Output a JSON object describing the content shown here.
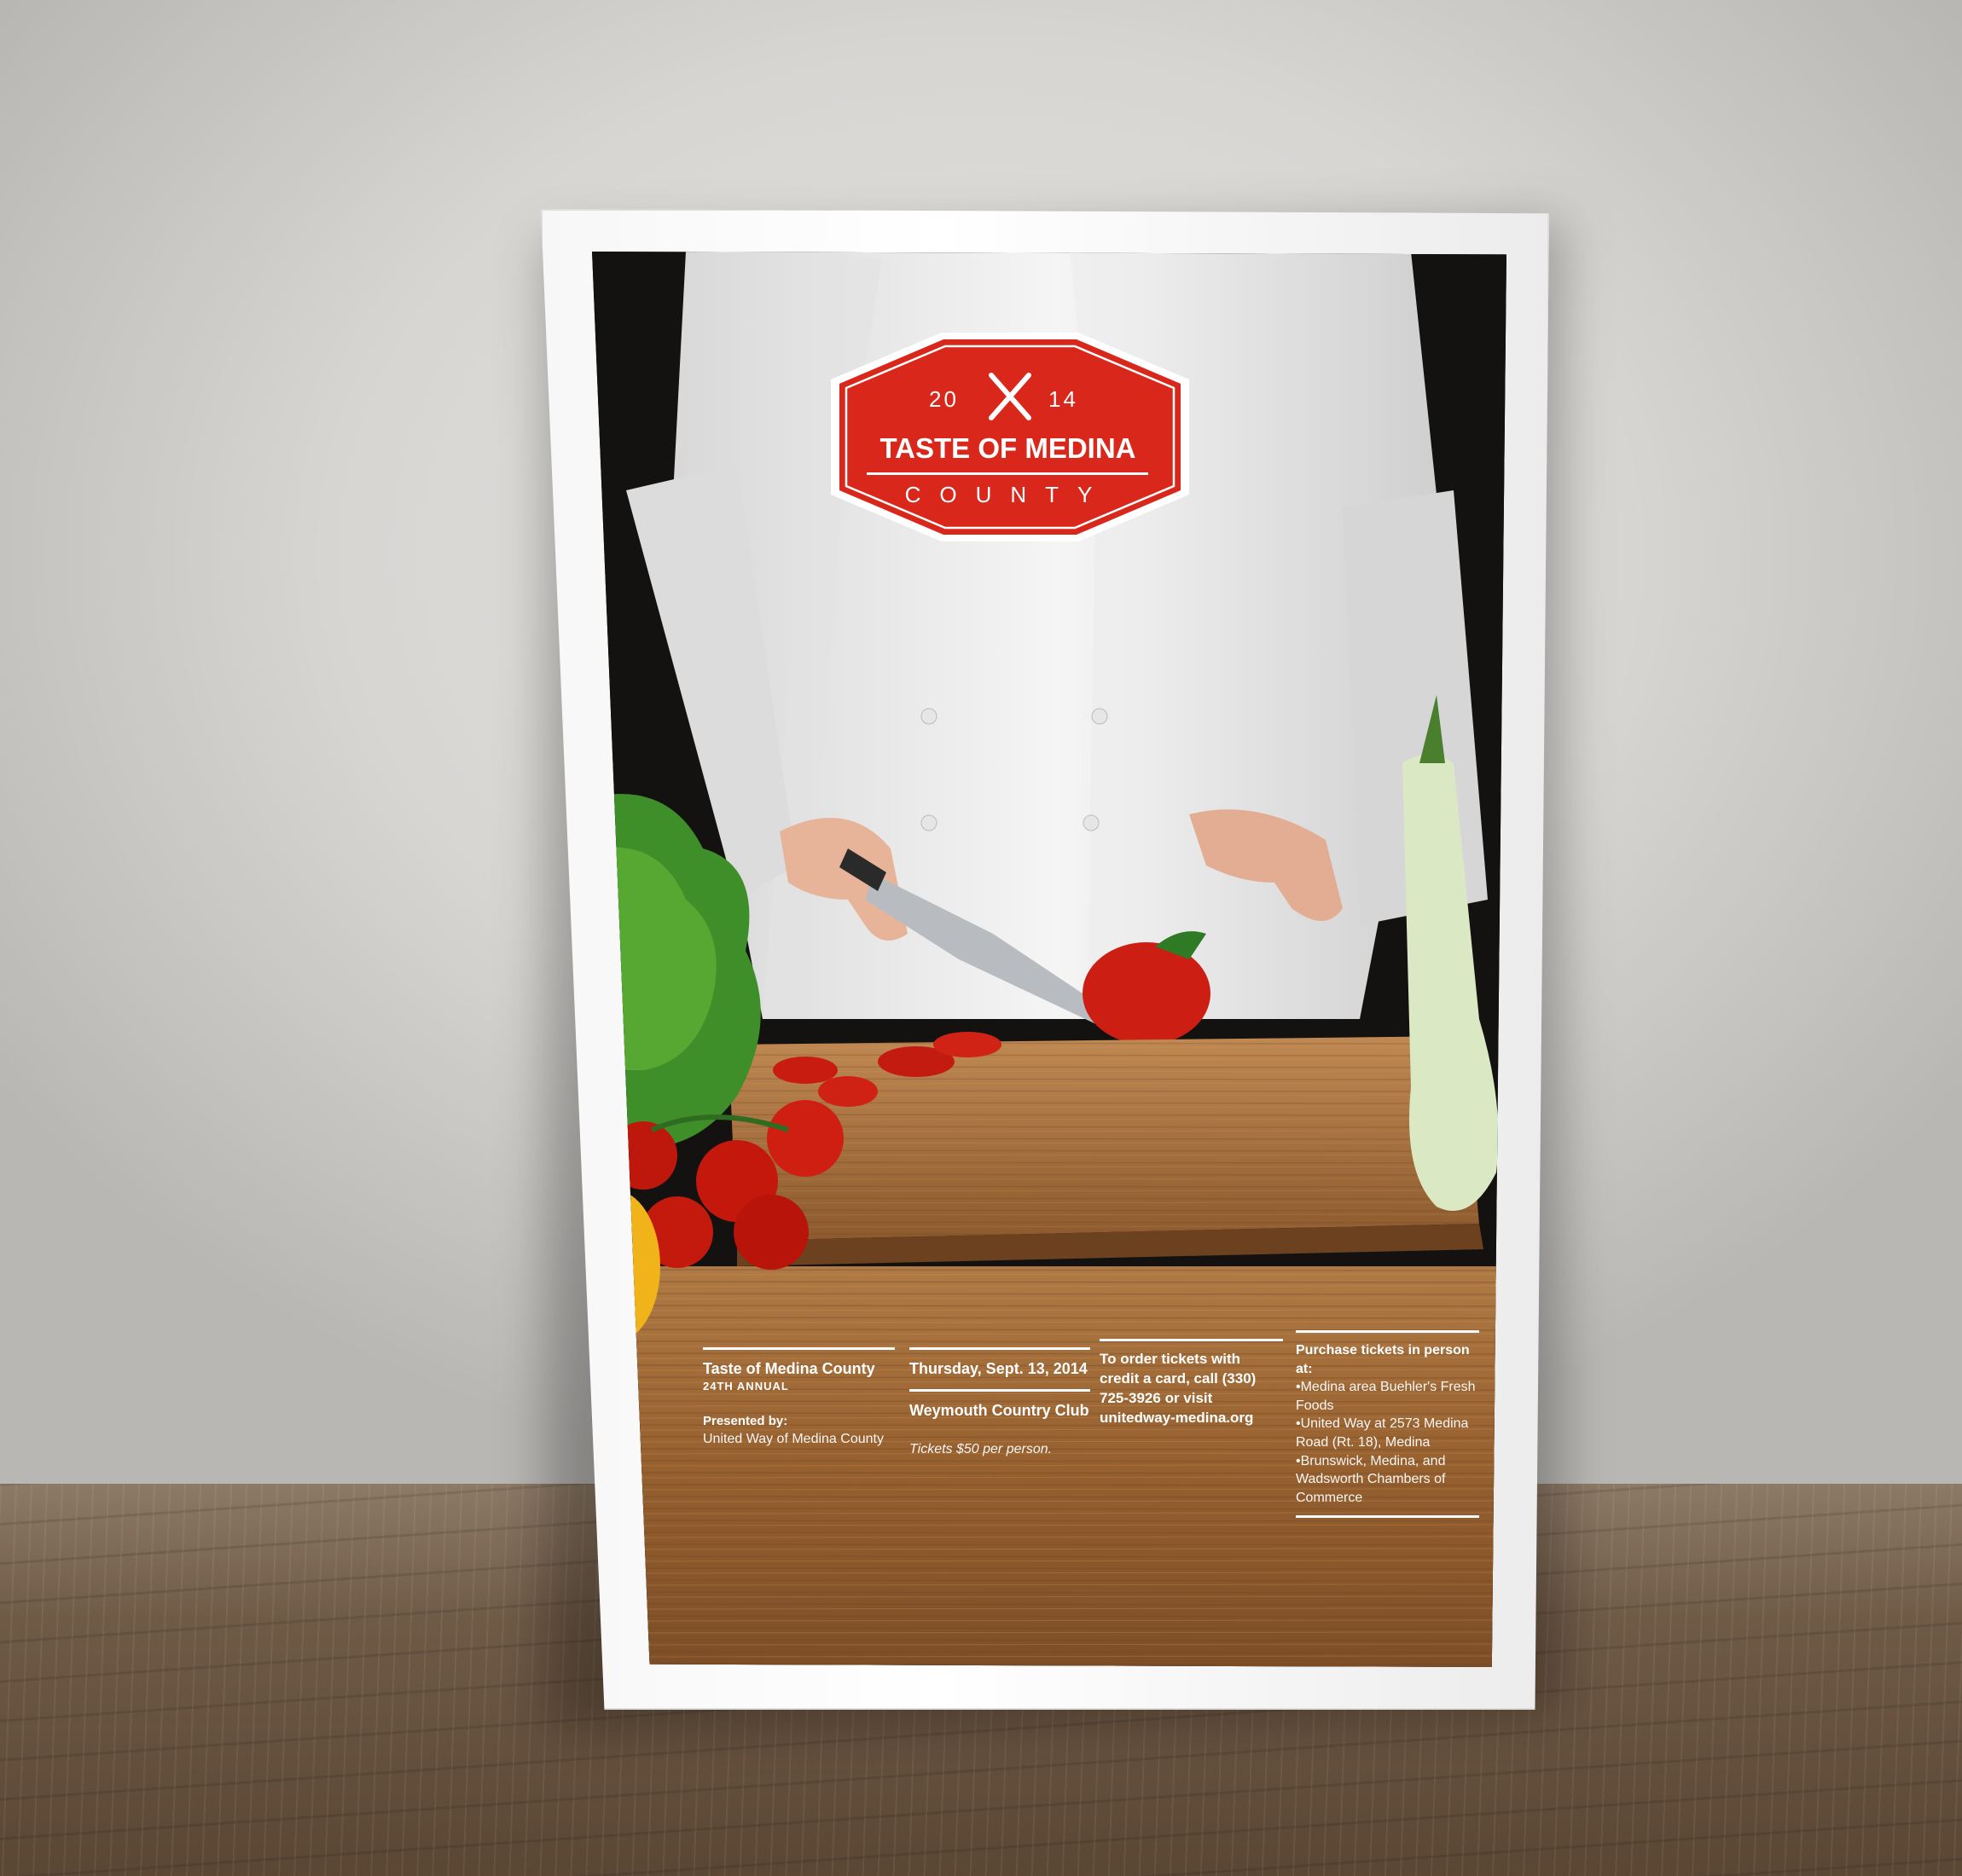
{
  "poster": {
    "badge": {
      "year_left": "20",
      "year_right": "14",
      "title": "TASTE OF MEDINA",
      "subtitle": "COUNTY",
      "color": "#d9271b"
    },
    "col1": {
      "event_name": "Taste of Medina County",
      "edition": "24TH ANNUAL",
      "presented_label": "Presented by:",
      "presenter": "United Way of Medina County"
    },
    "col2": {
      "date": "Thursday, Sept. 13, 2014",
      "venue": "Weymouth Country Club",
      "price": "Tickets $50 per person."
    },
    "col3": {
      "order_text": "To order tickets with credit a card, call (330) 725-3926 or visit unitedway-medina.org"
    },
    "col4": {
      "heading": "Purchase tickets in person at:",
      "item1": "•Medina area Buehler's Fresh Foods",
      "item2": "•United Way at 2573 Medina Road (Rt. 18), Medina",
      "item3": "•Brunswick, Medina, and Wadsworth Chambers of Commerce"
    }
  }
}
